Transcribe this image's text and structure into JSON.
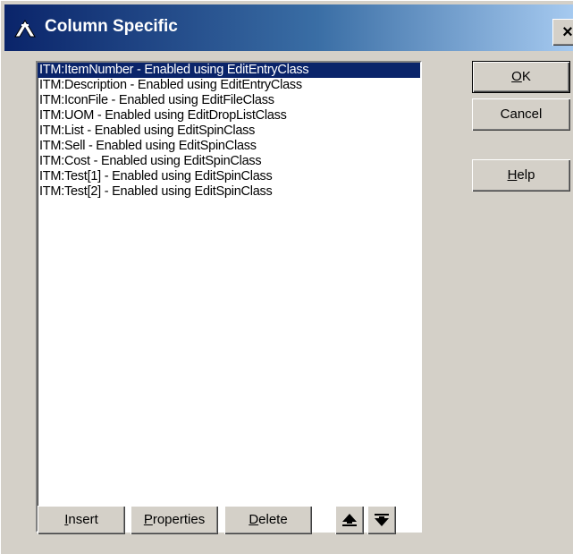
{
  "window": {
    "title": "Column Specific",
    "close_glyph": "×"
  },
  "list": {
    "items": [
      "ITM:ItemNumber - Enabled using EditEntryClass",
      "ITM:Description - Enabled using EditEntryClass",
      "ITM:IconFile - Enabled using EditFileClass",
      "ITM:UOM - Enabled using EditDropListClass",
      "ITM:List - Enabled using EditSpinClass",
      "ITM:Sell - Enabled using EditSpinClass",
      "ITM:Cost - Enabled using EditSpinClass",
      "ITM:Test[1] - Enabled using EditSpinClass",
      "ITM:Test[2] - Enabled using EditSpinClass"
    ],
    "selected_index": 0
  },
  "buttons": {
    "ok": {
      "mnemonic": "O",
      "rest": "K"
    },
    "cancel": {
      "label": "Cancel"
    },
    "help": {
      "mnemonic": "H",
      "rest": "elp"
    },
    "insert": {
      "mnemonic": "I",
      "rest": "nsert"
    },
    "properties": {
      "mnemonic": "P",
      "rest": "roperties"
    },
    "delete": {
      "mnemonic": "D",
      "rest": "elete"
    }
  },
  "icons": {
    "title": "app-icon",
    "move_up": "move-up-icon",
    "move_down": "move-down-icon"
  },
  "colors": {
    "title_start": "#0a246a",
    "title_end": "#a6caf0",
    "selection": "#0a246a",
    "face": "#d4d0c8"
  }
}
